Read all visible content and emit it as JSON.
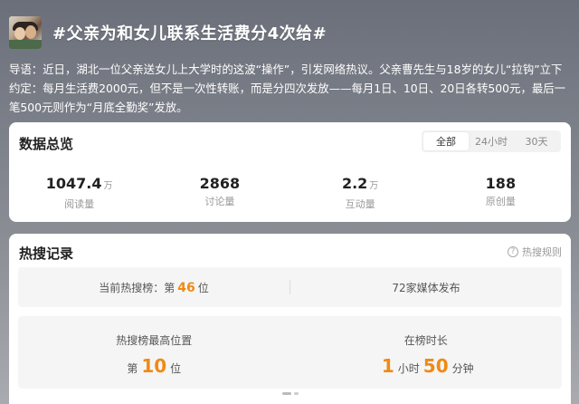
{
  "topic": {
    "title": "#父亲为和女儿联系生活费分4次给#",
    "intro": "导语：近日，湖北一位父亲送女儿上大学时的这波“操作”，引发网络热议。父亲曹先生与18岁的女儿“拉钩”立下约定：每月生活费2000元，但不是一次性转账，而是分四次发放——每月1日、10日、20日各转500元，最后一笔500元则作为“月底全勤奖”发放。"
  },
  "overview": {
    "title": "数据总览",
    "tabs": [
      "全部",
      "24小时",
      "30天"
    ],
    "stats": [
      {
        "value": "1047.4",
        "unit": "万",
        "label": "阅读量"
      },
      {
        "value": "2868",
        "unit": "",
        "label": "讨论量"
      },
      {
        "value": "2.2",
        "unit": "万",
        "label": "互动量"
      },
      {
        "value": "188",
        "unit": "",
        "label": "原创量"
      }
    ]
  },
  "hot": {
    "title": "热搜记录",
    "rules_label": "热搜规则",
    "current_prefix": "当前热搜榜：第",
    "current_rank": "46",
    "current_suffix": "位",
    "media": "72家媒体发布",
    "peak_label": "热搜榜最高位置",
    "peak_prefix": "第",
    "peak_rank": "10",
    "peak_suffix": "位",
    "duration_label": "在榜时长",
    "duration_hours": "1",
    "hours_unit": "小时",
    "duration_minutes": "50",
    "minutes_unit": "分钟"
  },
  "colors": {
    "accent": "#f08a14"
  }
}
